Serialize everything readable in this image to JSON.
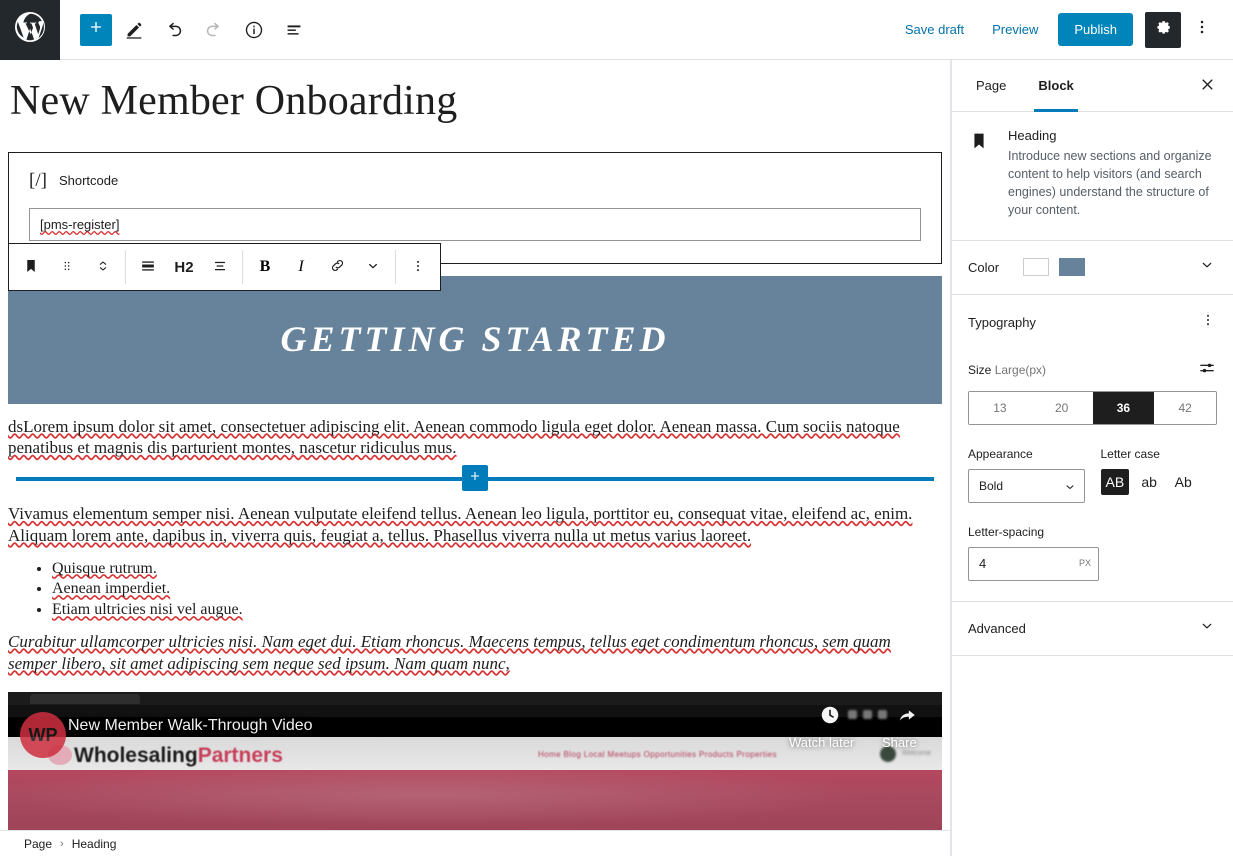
{
  "topbar": {
    "logo_icon": "wordpress-logo-icon",
    "add_icon": "plus-icon",
    "edit_icon": "pencil-icon",
    "undo_icon": "undo-arrow-icon",
    "redo_icon": "redo-arrow-icon",
    "info_icon": "info-circle-icon",
    "list_view_icon": "list-view-icon",
    "save_draft_label": "Save draft",
    "preview_label": "Preview",
    "publish_label": "Publish",
    "settings_icon": "gear-icon",
    "more_icon": "kebab-menu-icon"
  },
  "editor": {
    "post_title": "New Member Onboarding",
    "shortcode_block": {
      "icon": "[/]",
      "label": "Shortcode",
      "value": "[pms-register]",
      "misspelled": "pms"
    },
    "block_toolbar": {
      "block_type_icon": "heading-bookmark-icon",
      "drag_icon": "drag-handle-icon",
      "move_icon": "move-up-down-icon",
      "align_icon": "align-text-icon",
      "level_label": "H2",
      "text_align_icon": "text-align-icon",
      "bold_label": "B",
      "italic_label": "I",
      "link_icon": "link-icon",
      "more_formats_icon": "chevron-down-icon",
      "options_icon": "kebab-menu-icon"
    },
    "heading_block": {
      "text": "GETTING STARTED",
      "background_color": "#67839b",
      "text_color": "#ffffff"
    },
    "paragraph_1": "dsLorem ipsum dolor sit amet, consectetuer adipiscing elit. Aenean commodo ligula eget dolor. Aenean massa. Cum sociis natoque penatibus et magnis dis parturient montes, nascetur ridiculus mus.",
    "inserter": {
      "icon": "plus-icon",
      "color": "#007cba"
    },
    "paragraph_2": "Vivamus elementum semper nisi. Aenean vulputate eleifend tellus. Aenean leo ligula, porttitor eu, consequat vitae, eleifend ac, enim. Aliquam lorem ante, dapibus in, viverra quis, feugiat a, tellus. Phasellus viverra nulla ut metus varius laoreet.",
    "bullets": [
      "Quisque rutrum.",
      "Aenean imperdiet.",
      "Etiam ultricies nisi vel augue."
    ],
    "paragraph_3": "Curabitur ullamcorper ultricies nisi. Nam eget dui. Etiam rhoncus. Maecens tempus, tellus eget condimentum rhoncus, sem quam semper libero, sit amet adipiscing sem neque sed ipsum. Nam quam nunc,",
    "video": {
      "title": "New Member Walk-Through Video",
      "channel_badge": "WP",
      "site_logo_part1": "Wholesaling",
      "site_logo_part2": "Partners",
      "nav_items": "Home  Blog  Local Meetups  Opportunities  Products  Properties",
      "watch_later_label": "Watch later",
      "share_label": "Share",
      "watch_later_icon": "clock-icon",
      "share_icon": "share-arrow-icon"
    }
  },
  "breadcrumb": {
    "items": [
      "Page",
      "Heading"
    ],
    "separator": "›"
  },
  "sidebar": {
    "tabs": [
      {
        "label": "Page",
        "active": false
      },
      {
        "label": "Block",
        "active": true
      }
    ],
    "close_icon": "close-x-icon",
    "block_card": {
      "icon": "heading-bookmark-icon",
      "name": "Heading",
      "description": "Introduce new sections and organize content to help visitors (and search engines) understand the structure of your content."
    },
    "color": {
      "label": "Color",
      "swatch_text": "#ffffff",
      "swatch_background": "#67839b",
      "chevron_icon": "chevron-down-icon"
    },
    "typography": {
      "title": "Typography",
      "options_icon": "kebab-menu-icon",
      "size_label": "Size",
      "size_value_label": "Large(px)",
      "size_settings_icon": "sliders-icon",
      "size_options": [
        "13",
        "20",
        "36",
        "42"
      ],
      "size_selected": "36",
      "appearance_label": "Appearance",
      "appearance_value": "Bold",
      "appearance_chevron_icon": "chevron-down-icon",
      "letter_case_label": "Letter case",
      "letter_case_options": [
        "AB",
        "ab",
        "Ab"
      ],
      "letter_case_selected": "AB",
      "letter_spacing_label": "Letter-spacing",
      "letter_spacing_value": "4",
      "letter_spacing_unit": "PX"
    },
    "advanced": {
      "label": "Advanced",
      "chevron_icon": "chevron-down-icon"
    }
  }
}
